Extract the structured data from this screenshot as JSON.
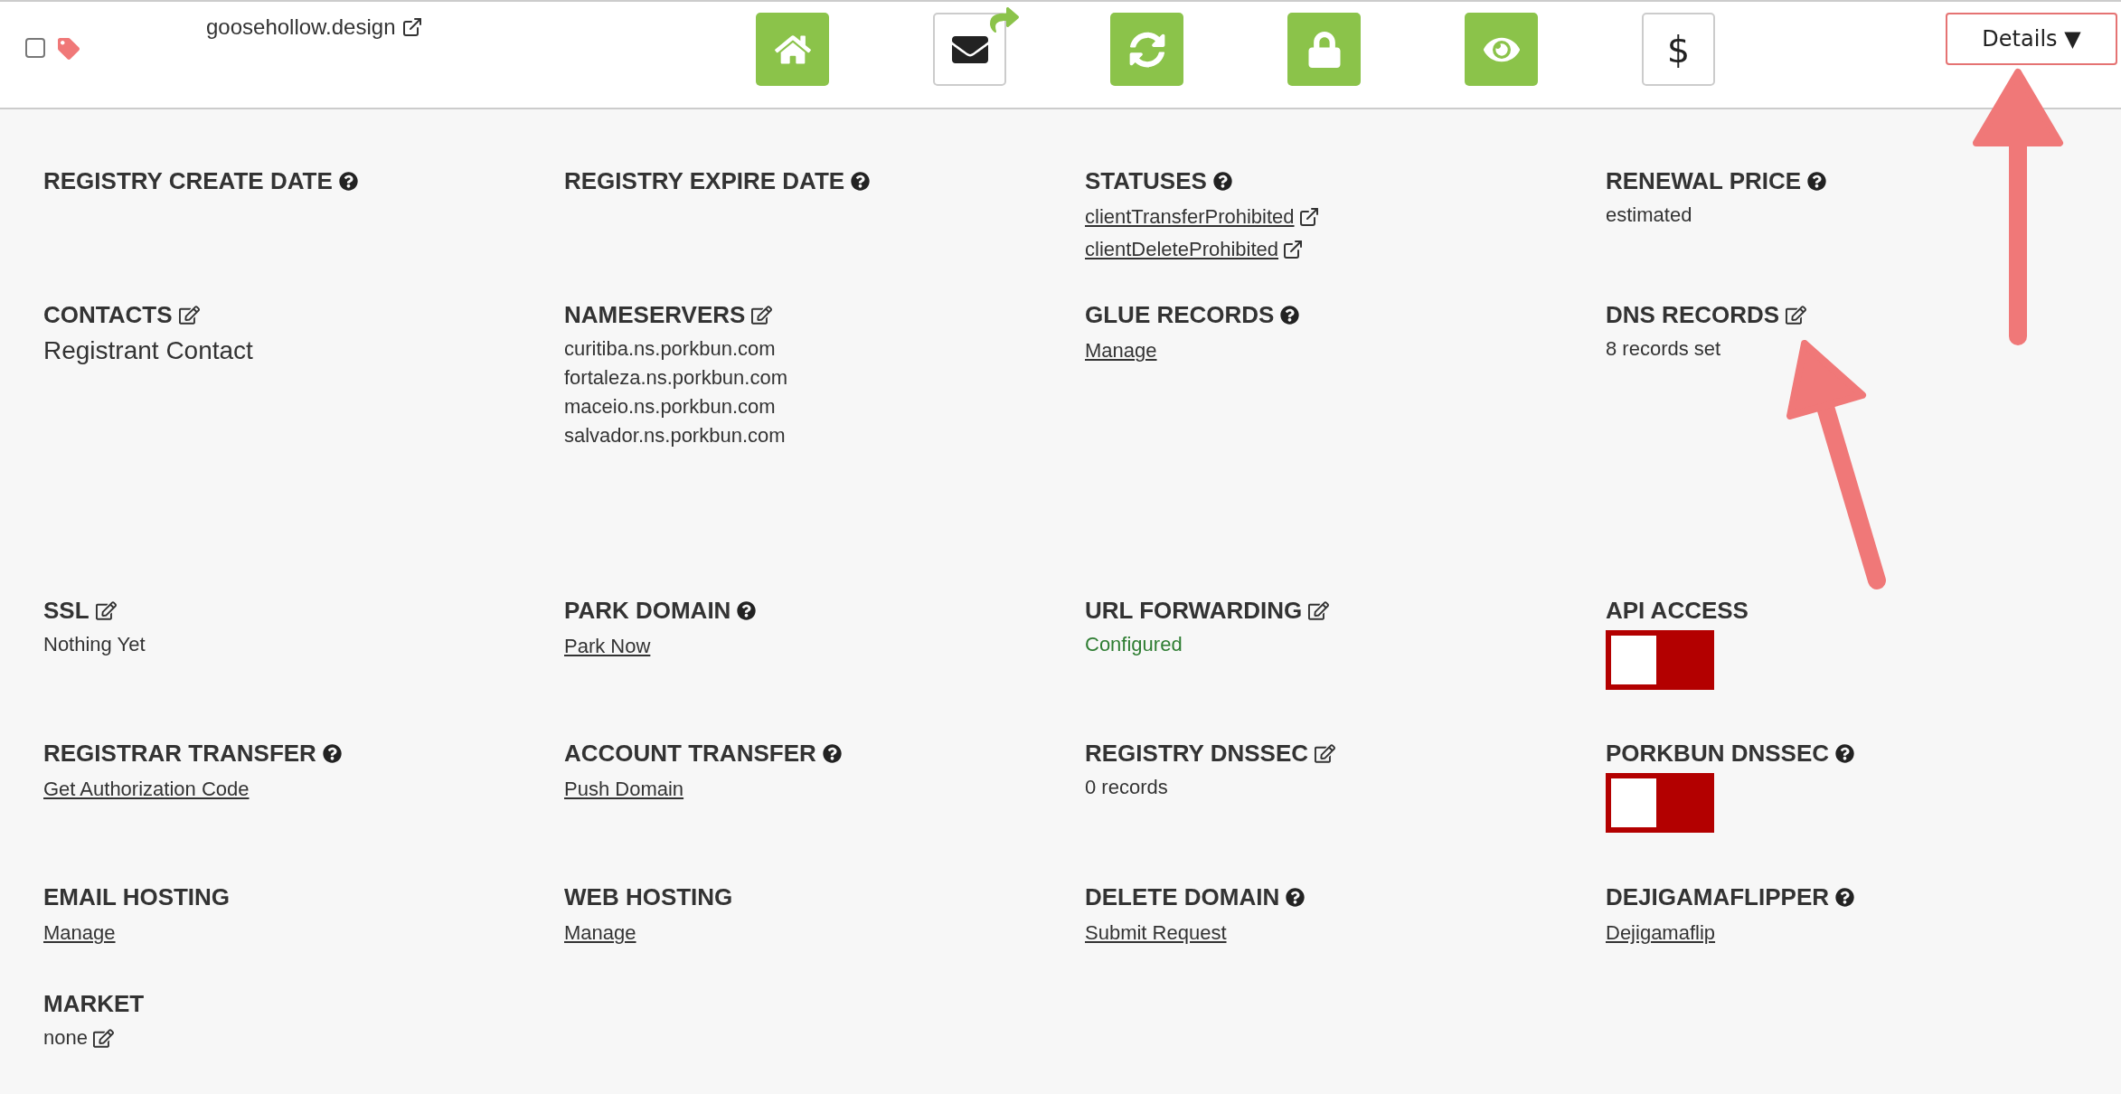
{
  "top_bar": {
    "checkbox": {
      "checked": false
    },
    "domain": "goosehollow.design",
    "actions": [
      {
        "active": true
      },
      {
        "active": false
      },
      {
        "active": true
      },
      {
        "active": true
      },
      {
        "active": true
      },
      {
        "active": false,
        "label": "$"
      }
    ],
    "details_button": "Details ▼"
  },
  "fields": [
    {
      "title": "REGISTRY CREATE DATE",
      "kind": "help"
    },
    {
      "title": "REGISTRY EXPIRE DATE",
      "kind": "help"
    },
    {
      "title": "STATUSES",
      "kind": "help",
      "values": [
        {
          "kind": "external_link",
          "text": "clientTransferProhibited"
        },
        {
          "kind": "external_link",
          "text": "clientDeleteProhibited"
        }
      ]
    },
    {
      "title": "RENEWAL PRICE",
      "kind": "help",
      "values": [
        {
          "kind": "text",
          "text": "estimated"
        }
      ]
    },
    {
      "title": "CONTACTS",
      "kind": "edit",
      "values": [
        {
          "kind": "large_text",
          "text": "Registrant Contact"
        }
      ]
    },
    {
      "title": "NAMESERVERS",
      "kind": "edit",
      "values": [
        {
          "kind": "text",
          "text": "curitiba.ns.porkbun.com"
        },
        {
          "kind": "text",
          "text": "fortaleza.ns.porkbun.com"
        },
        {
          "kind": "text",
          "text": "maceio.ns.porkbun.com"
        },
        {
          "kind": "text",
          "text": "salvador.ns.porkbun.com"
        }
      ]
    },
    {
      "title": "GLUE RECORDS",
      "kind": "help",
      "values": [
        {
          "kind": "link",
          "text": "Manage"
        }
      ]
    },
    {
      "title": "DNS RECORDS",
      "kind": "edit",
      "values": [
        {
          "kind": "text",
          "text": "8 records set"
        }
      ]
    },
    {
      "title": "SSL",
      "kind": "edit",
      "values": [
        {
          "kind": "text",
          "text": "Nothing Yet"
        }
      ]
    },
    {
      "title": "PARK DOMAIN",
      "kind": "help",
      "values": [
        {
          "kind": "link",
          "text": "Park Now"
        }
      ]
    },
    {
      "title": "URL FORWARDING",
      "kind": "edit",
      "values": [
        {
          "kind": "positive",
          "text": "Configured"
        }
      ]
    },
    {
      "title": "API ACCESS",
      "kind": "plain",
      "values": [
        {
          "kind": "toggle",
          "on": false
        }
      ]
    },
    {
      "title": "REGISTRAR TRANSFER",
      "kind": "help",
      "values": [
        {
          "kind": "link",
          "text": "Get Authorization Code"
        }
      ]
    },
    {
      "title": "ACCOUNT TRANSFER",
      "kind": "help",
      "values": [
        {
          "kind": "link",
          "text": "Push Domain"
        }
      ]
    },
    {
      "title": "REGISTRY DNSSEC",
      "kind": "edit",
      "values": [
        {
          "kind": "text",
          "text": "0 records"
        }
      ]
    },
    {
      "title": "PORKBUN DNSSEC",
      "kind": "help",
      "values": [
        {
          "kind": "toggle",
          "on": false
        }
      ]
    },
    {
      "title": "EMAIL HOSTING",
      "kind": "plain",
      "values": [
        {
          "kind": "link",
          "text": "Manage"
        }
      ]
    },
    {
      "title": "WEB HOSTING",
      "kind": "plain",
      "values": [
        {
          "kind": "link",
          "text": "Manage"
        }
      ]
    },
    {
      "title": "DELETE DOMAIN",
      "kind": "help",
      "values": [
        {
          "kind": "link",
          "text": "Submit Request"
        }
      ]
    },
    {
      "title": "DEJIGAMAFLIPPER",
      "kind": "help",
      "values": [
        {
          "kind": "link",
          "text": "Dejigamaflip"
        }
      ]
    },
    {
      "title": "MARKET",
      "kind": "plain",
      "values": [
        {
          "kind": "text_edit",
          "text": "none"
        }
      ]
    }
  ],
  "annotations": [
    {
      "kind": "arrow"
    },
    {
      "kind": "arrow"
    }
  ]
}
